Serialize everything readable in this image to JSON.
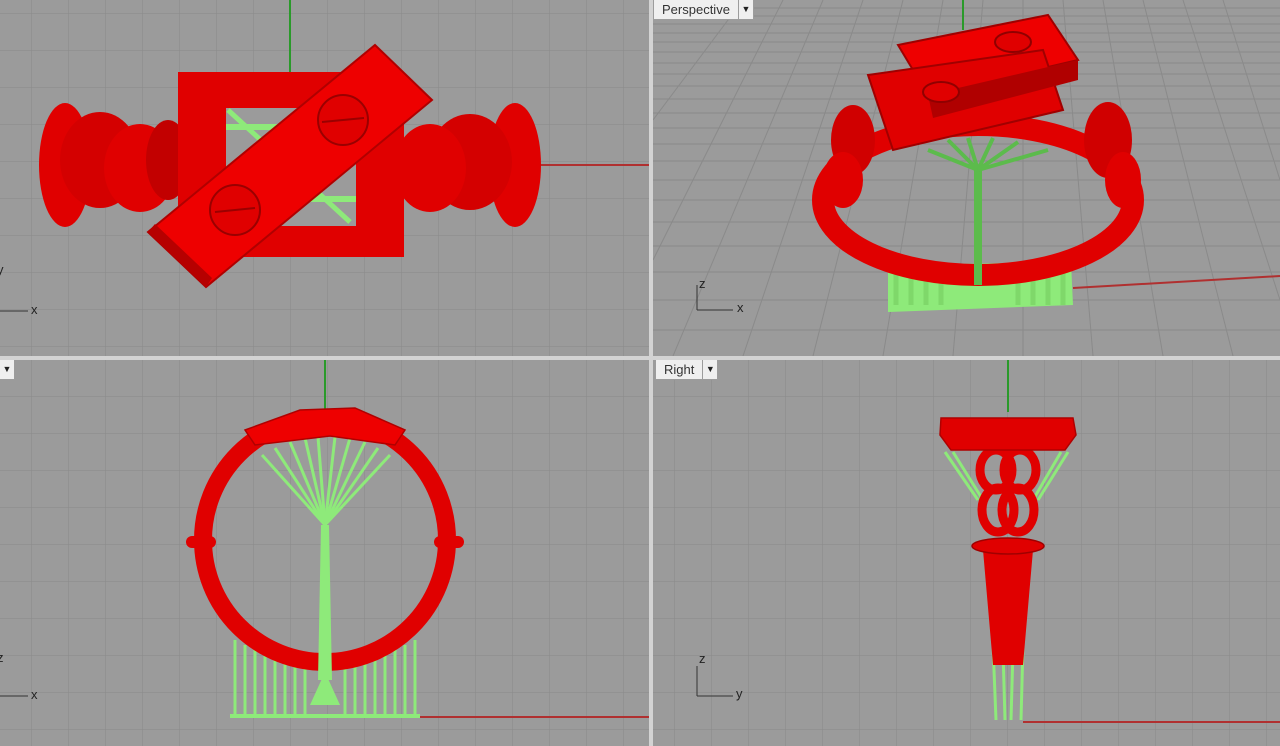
{
  "viewports": {
    "top": {
      "label": "",
      "axis_h": "x",
      "axis_v": "y"
    },
    "perspective": {
      "label": "Perspective",
      "axis_h": "x",
      "axis_v": "z"
    },
    "front": {
      "label": "",
      "axis_h": "x",
      "axis_v": "z"
    },
    "right": {
      "label": "Right",
      "axis_h": "y",
      "axis_v": "z"
    }
  },
  "icons": {
    "dropdown": "chevron-down-icon"
  },
  "colors": {
    "model": "#e00000",
    "supports": "#8eea7a",
    "x_axis": "#b03030",
    "y_axis": "#2a9a2a",
    "viewport_bg": "#9a9a9a",
    "grid": "#8a8a8a"
  }
}
